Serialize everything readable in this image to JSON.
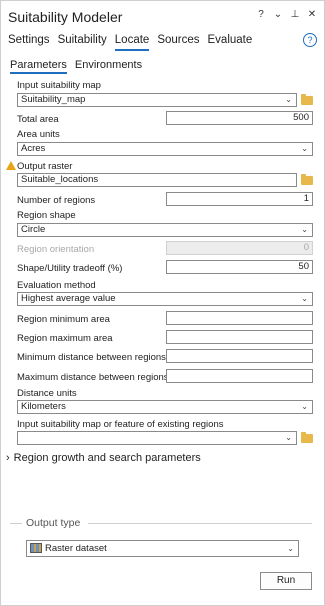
{
  "pane": {
    "title": "Suitability Modeler",
    "icons": [
      "help-icon",
      "chevron-down-icon",
      "pin-icon",
      "close-icon"
    ]
  },
  "tabs": [
    "Settings",
    "Suitability",
    "Locate",
    "Sources",
    "Evaluate"
  ],
  "active_tab": "Locate",
  "subtabs": [
    "Parameters",
    "Environments"
  ],
  "active_subtab": "Parameters",
  "fields": {
    "input_map_label": "Input suitability map",
    "input_map_value": "Suitability_map",
    "total_area_label": "Total area",
    "total_area_value": "500",
    "area_units_label": "Area units",
    "area_units_value": "Acres",
    "output_raster_label": "Output raster",
    "output_raster_value": "Suitable_locations",
    "num_regions_label": "Number of regions",
    "num_regions_value": "1",
    "region_shape_label": "Region shape",
    "region_shape_value": "Circle",
    "region_orientation_label": "Region orientation",
    "region_orientation_value": "0",
    "shape_tradeoff_label": "Shape/Utility tradeoff (%)",
    "shape_tradeoff_value": "50",
    "eval_method_label": "Evaluation method",
    "eval_method_value": "Highest average value",
    "region_min_label": "Region minimum area",
    "region_min_value": "",
    "region_max_label": "Region maximum area",
    "region_max_value": "",
    "min_dist_label": "Minimum distance between regions",
    "min_dist_value": "",
    "max_dist_label": "Maximum distance between regions",
    "max_dist_value": "",
    "dist_units_label": "Distance units",
    "dist_units_value": "Kilometers",
    "existing_label": "Input suitability map or feature of existing regions",
    "existing_value": ""
  },
  "section_growth": "Region growth and search parameters",
  "output_type_label": "Output type",
  "output_type_value": "Raster dataset",
  "run_label": "Run",
  "colors": {
    "accent": "#1e6fbf",
    "warning": "#e8a317",
    "folder": "#e8b84a"
  }
}
